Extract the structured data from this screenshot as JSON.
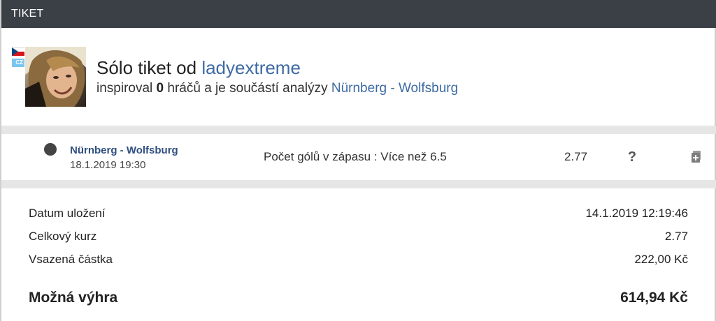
{
  "header": {
    "title": "TIKET"
  },
  "author": {
    "country_code": "CZ",
    "title_prefix": "Sólo tiket od ",
    "username": "ladyextreme",
    "sub_prefix": "inspiroval ",
    "inspired_count": "0",
    "sub_middle": " hráčů a je součástí analýzy ",
    "analysis_match": "Nürnberg - Wolfsburg"
  },
  "bet": {
    "match": "Nürnberg - Wolfsburg",
    "datetime": "18.1.2019 19:30",
    "type": "Počet gólů v zápasu : Více než 6.5",
    "odds": "2.77",
    "help_label": "?",
    "status": "pending",
    "icons": {
      "status": "status-dot-icon",
      "help": "question-icon",
      "copy": "copy-ticket-icon"
    }
  },
  "summary": {
    "saved_label": "Datum uložení",
    "saved_value": "14.1.2019 12:19:46",
    "odds_label": "Celkový kurz",
    "odds_value": "2.77",
    "stake_label": "Vsazená částka",
    "stake_value": "222,00 Kč",
    "win_label": "Možná výhra",
    "win_value": "614,94 Kč"
  },
  "colors": {
    "header_bg": "#3a4046",
    "link": "#3d6aa3",
    "separator": "#e6e6e6"
  }
}
